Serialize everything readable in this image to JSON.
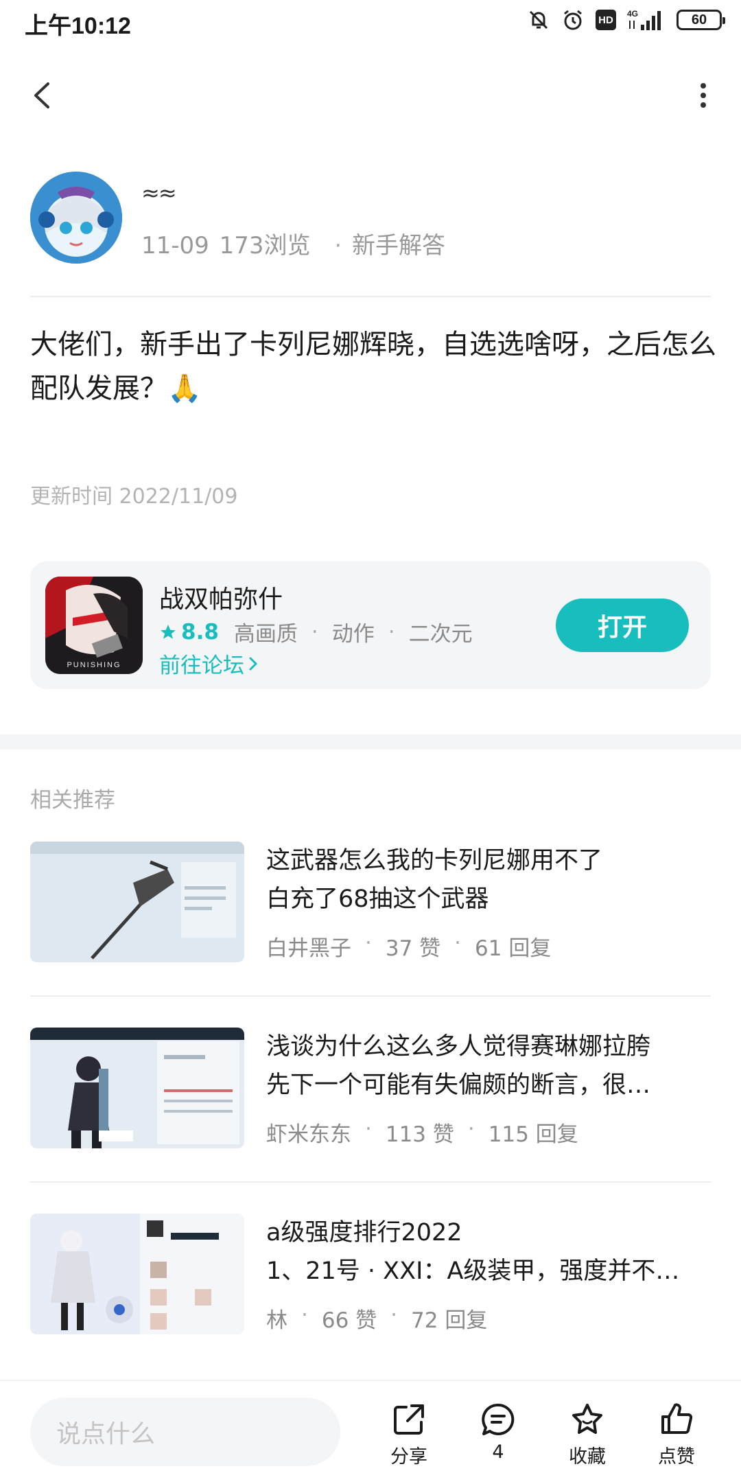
{
  "status": {
    "time": "上午10:12",
    "network": "4G",
    "hd": "HD",
    "battery": "60"
  },
  "post": {
    "author_name": "≈≈",
    "date": "11-09",
    "views": "173浏览",
    "category": "新手解答",
    "content": "大佬们，新手出了卡列尼娜辉晓，自选选啥呀，之后怎么配队发展？🙏",
    "update_time": "更新时间 2022/11/09"
  },
  "game": {
    "name": "战双帕弥什",
    "rating": "8.8",
    "tags": [
      "高画质",
      "动作",
      "二次元"
    ],
    "forum_link": "前往论坛",
    "open_label": "打开",
    "icon_text": "PUNISHING"
  },
  "related": {
    "title": "相关推荐",
    "items": [
      {
        "line1": "这武器怎么我的卡列尼娜用不了",
        "line2": "白充了68抽这个武器",
        "author": "白井黑子",
        "likes": "37 赞",
        "replies": "61 回复"
      },
      {
        "line1": "浅谈为什么这么多人觉得赛琳娜拉胯",
        "line2": "先下一个可能有失偏颇的断言，很…",
        "author": "虾米东东",
        "likes": "113 赞",
        "replies": "115 回复"
      },
      {
        "line1": "a级强度排行2022",
        "line2": "1、21号 · XXI：A级装甲，强度并不…",
        "author": "林",
        "likes": "66 赞",
        "replies": "72 回复"
      }
    ]
  },
  "bottom": {
    "placeholder": "说点什么",
    "share": "分享",
    "comments": "4",
    "favorite": "收藏",
    "like": "点赞"
  },
  "colors": {
    "accent": "#18bdbe",
    "muted": "#999999",
    "card_bg": "#f4f5f7"
  }
}
